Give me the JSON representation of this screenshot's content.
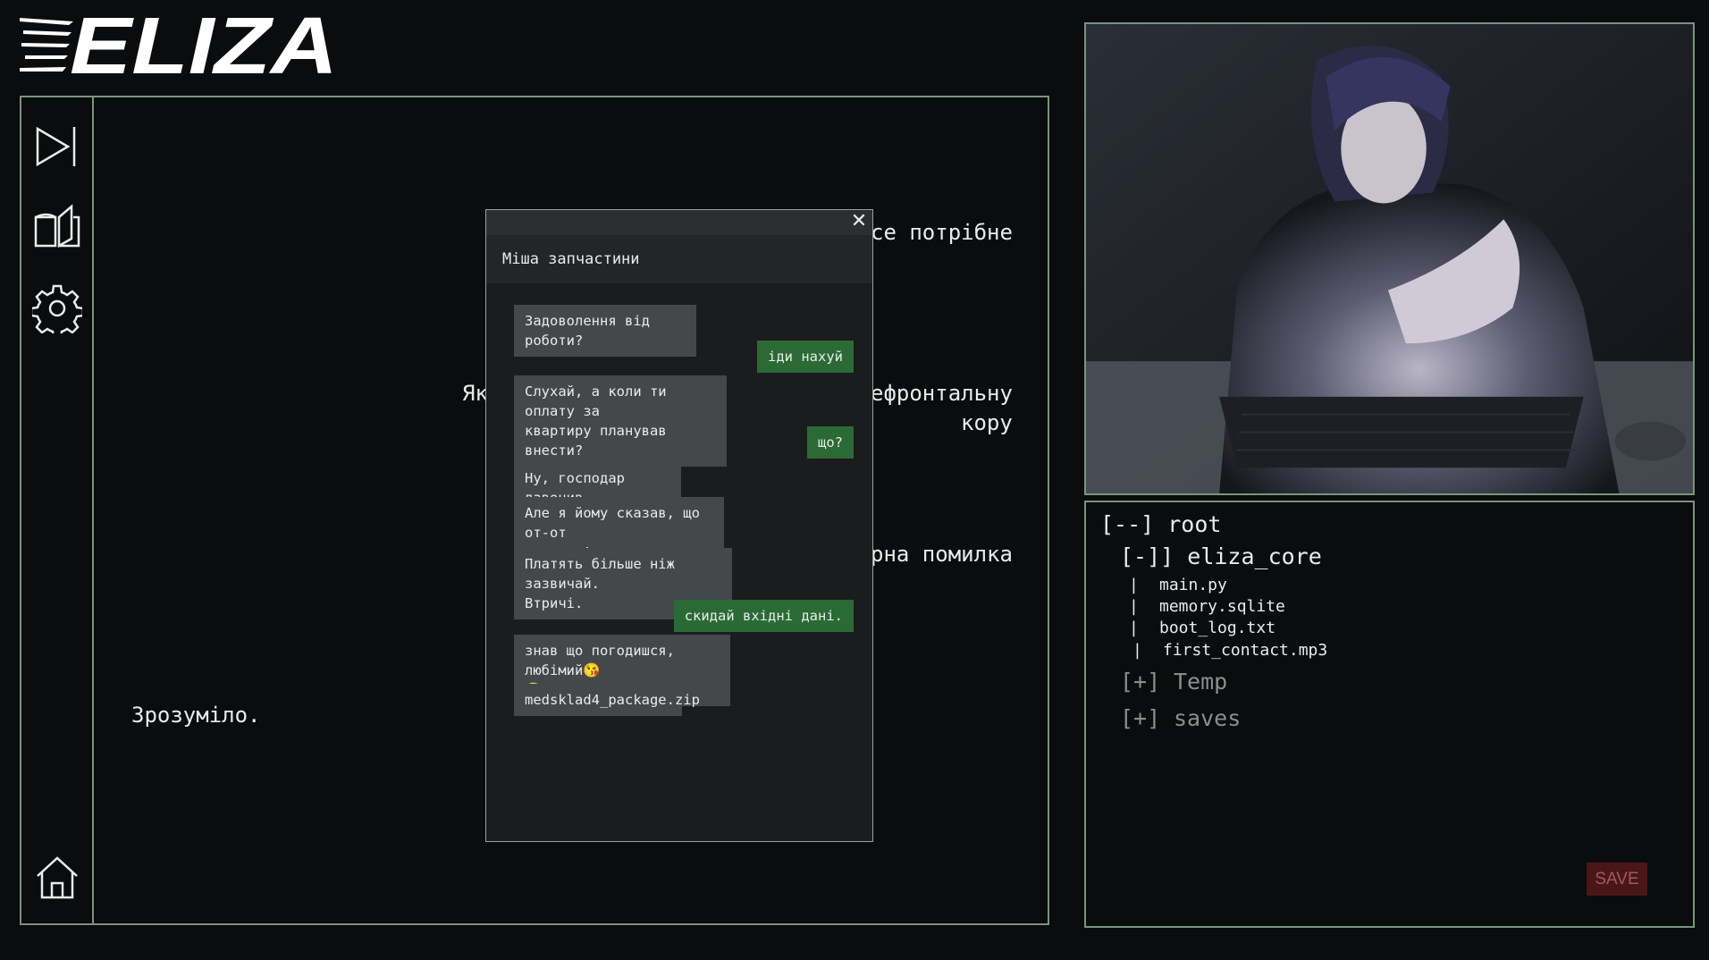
{
  "app": {
    "logo_text": "ELIZA"
  },
  "sidebar": {
    "icons": [
      "skip-forward-icon",
      "book-icon",
      "gear-icon",
      "home-icon"
    ]
  },
  "story": {
    "line1": "се потрібне",
    "line2a": "Як",
    "line2b": "ефронтальну",
    "line2c": "кору",
    "line3": "рна помилка",
    "line4": "Зрозуміло."
  },
  "phone": {
    "contact_name": "Міша запчастини",
    "close_symbol": "✕",
    "messages": [
      {
        "dir": "in",
        "text": "Задоволення від роботи?"
      },
      {
        "dir": "out",
        "text": "іди нахуй"
      },
      {
        "dir": "in",
        "text": "Слухай, а коли ти оплату за\nквартиру планував внести?"
      },
      {
        "dir": "out",
        "text": "що?"
      },
      {
        "dir": "in",
        "text": "Ну, господар дзвонив."
      },
      {
        "dir": "in",
        "text": "Але я йому сказав, що от-от\nзанесеш!"
      },
      {
        "dir": "in",
        "text": "Платять більше ніж зазвичай.\nВтричі."
      },
      {
        "dir": "out",
        "text": "скидай вхідні дані."
      },
      {
        "dir": "in",
        "text": "знав що погодишся, любімий😘\n😘"
      },
      {
        "dir": "in",
        "text": "medsklad4_package.zip"
      }
    ]
  },
  "files": {
    "root": "[--] root",
    "core": "[-]] eliza_core",
    "items": [
      {
        "prefix": "|",
        "name": "main.py"
      },
      {
        "prefix": "|",
        "name": "memory.sqlite"
      },
      {
        "prefix": "|",
        "name": "boot_log.txt"
      },
      {
        "prefix": "|",
        "name": "first_contact.mp3"
      }
    ],
    "folders": [
      {
        "toggle": "[+]",
        "name": "Temp"
      },
      {
        "toggle": "[+]",
        "name": "saves"
      }
    ],
    "save_label": "SAVE"
  },
  "colors": {
    "frame": "#7a947c",
    "outgoing": "#2b6a35",
    "incoming": "#45484b",
    "save_bg": "#4a1618"
  }
}
